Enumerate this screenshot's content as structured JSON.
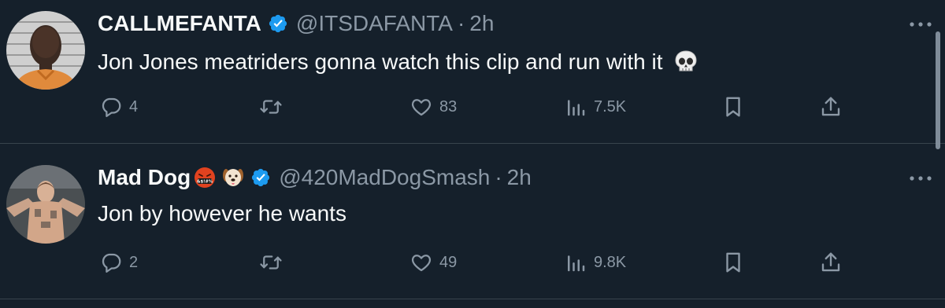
{
  "theme": {
    "background": "#15202b",
    "text_primary": "#f7f9f9",
    "text_secondary": "#8b98a5",
    "verified_blue": "#1d9bf0",
    "divider": "#38444d"
  },
  "tweets": [
    {
      "display_name": "CALLMEFANTA",
      "verified": true,
      "handle": "@ITSDAFANTA",
      "separator": "·",
      "time": "2h",
      "text": "Jon Jones meatriders gonna watch this clip and run with it",
      "text_emoji": "skull-emoji",
      "avatar_icon": "profile-photo-man",
      "replies": "4",
      "retweets": "",
      "likes": "83",
      "views": "7.5K"
    },
    {
      "display_name": "Mad Dog",
      "name_emojis": [
        "cursing-face-emoji",
        "dog-face-emoji"
      ],
      "verified": true,
      "handle": "@420MadDogSmash",
      "separator": "·",
      "time": "2h",
      "text": "Jon by however he wants",
      "avatar_icon": "profile-photo-fighter",
      "replies": "2",
      "retweets": "",
      "likes": "49",
      "views": "9.8K"
    }
  ]
}
